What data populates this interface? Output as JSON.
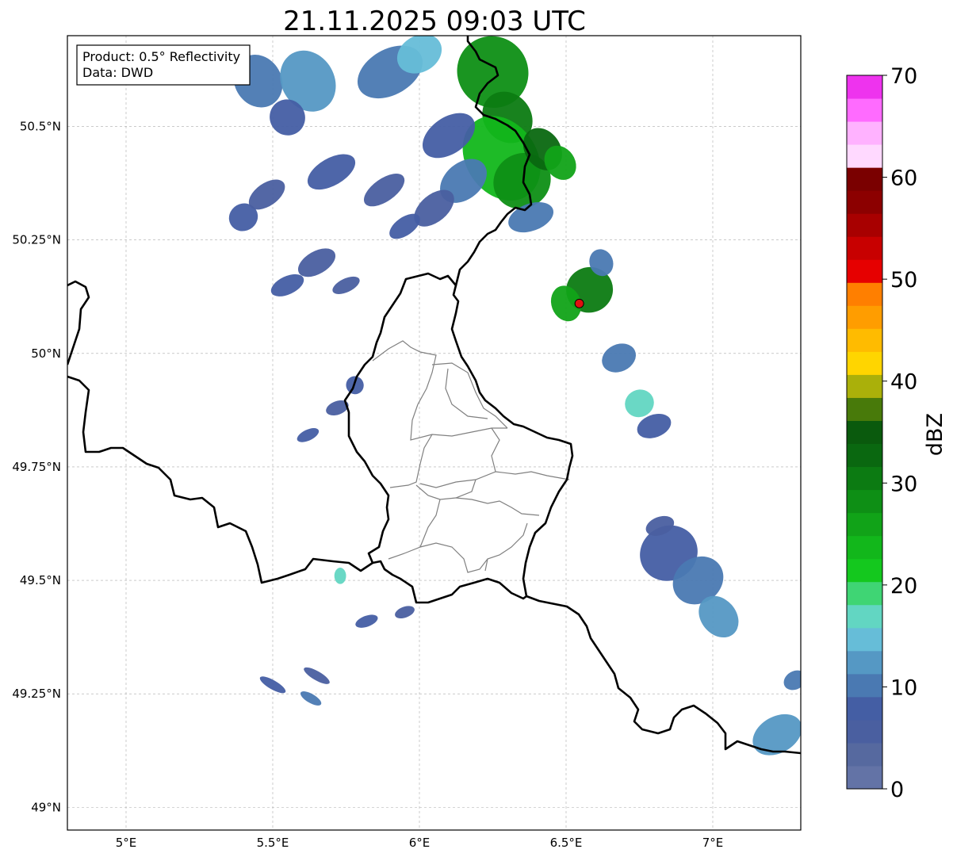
{
  "title": "21.11.2025 09:03 UTC",
  "legend": {
    "product": "Product: 0.5° Reflectivity",
    "data": "Data: DWD"
  },
  "axes": {
    "x_ticks": [
      {
        "value": 5.0,
        "label": "5°E"
      },
      {
        "value": 5.5,
        "label": "5.5°E"
      },
      {
        "value": 6.0,
        "label": "6°E"
      },
      {
        "value": 6.5,
        "label": "6.5°E"
      },
      {
        "value": 7.0,
        "label": "7°E"
      }
    ],
    "y_ticks": [
      {
        "value": 49.0,
        "label": "49°N"
      },
      {
        "value": 49.25,
        "label": "49.25°N"
      },
      {
        "value": 49.5,
        "label": "49.5°N"
      },
      {
        "value": 49.75,
        "label": "49.75°N"
      },
      {
        "value": 50.0,
        "label": "50°N"
      },
      {
        "value": 50.25,
        "label": "50.25°N"
      },
      {
        "value": 50.5,
        "label": "50.5°N"
      }
    ],
    "xlim": [
      4.8,
      7.3
    ],
    "ylim": [
      48.95,
      50.7
    ],
    "grid": true
  },
  "colorbar": {
    "label": "dBZ",
    "range": [
      0,
      70
    ],
    "tick_labels": [
      {
        "value": 0,
        "label": "0"
      },
      {
        "value": 10,
        "label": "10"
      },
      {
        "value": 20,
        "label": "20"
      },
      {
        "value": 30,
        "label": "30"
      },
      {
        "value": 40,
        "label": "40"
      },
      {
        "value": 50,
        "label": "50"
      },
      {
        "value": 60,
        "label": "60"
      },
      {
        "value": 70,
        "label": "70"
      }
    ],
    "colors": [
      "#6373a6",
      "#56699f",
      "#4a5fa0",
      "#445ea4",
      "#4a79b2",
      "#5598c4",
      "#66bdd8",
      "#62d6c2",
      "#3fd574",
      "#14c81e",
      "#12b71b",
      "#11a318",
      "#0e8f15",
      "#0c7b12",
      "#0a6810",
      "#0a5a0d",
      "#487a0a",
      "#aab00a",
      "#ffd500",
      "#ffbb00",
      "#ff9d00",
      "#ff7f00",
      "#e60000",
      "#c80000",
      "#a80000",
      "#8c0000",
      "#7a0000",
      "#ffd9ff",
      "#ffb2ff",
      "#ff6bff",
      "#ee33ee"
    ]
  },
  "marker": {
    "lon": 6.545,
    "lat": 50.11,
    "color": "#e01010"
  },
  "colors": {
    "border": "#000000",
    "district": "#808080",
    "grid": "#aaaaaa"
  },
  "echoes": [
    {
      "lon": 5.45,
      "lat": 50.6,
      "rx": 0.08,
      "ry": 0.06,
      "rot": -30,
      "c": 4
    },
    {
      "lon": 5.62,
      "lat": 50.6,
      "rx": 0.09,
      "ry": 0.07,
      "rot": -30,
      "c": 5
    },
    {
      "lon": 5.55,
      "lat": 50.52,
      "rx": 0.06,
      "ry": 0.04,
      "rot": -30,
      "c": 3
    },
    {
      "lon": 5.9,
      "lat": 50.62,
      "rx": 0.12,
      "ry": 0.05,
      "rot": -30,
      "c": 4
    },
    {
      "lon": 6.0,
      "lat": 50.66,
      "rx": 0.08,
      "ry": 0.04,
      "rot": -30,
      "c": 6
    },
    {
      "lon": 6.25,
      "lat": 50.62,
      "rx": 0.12,
      "ry": 0.08,
      "rot": -40,
      "c": 12
    },
    {
      "lon": 6.3,
      "lat": 50.52,
      "rx": 0.08,
      "ry": 0.06,
      "rot": -40,
      "c": 13
    },
    {
      "lon": 6.28,
      "lat": 50.43,
      "rx": 0.12,
      "ry": 0.1,
      "rot": -35,
      "c": 10
    },
    {
      "lon": 6.35,
      "lat": 50.38,
      "rx": 0.1,
      "ry": 0.06,
      "rot": -35,
      "c": 12
    },
    {
      "lon": 6.42,
      "lat": 50.45,
      "rx": 0.06,
      "ry": 0.05,
      "rot": -35,
      "c": 14
    },
    {
      "lon": 6.48,
      "lat": 50.42,
      "rx": 0.05,
      "ry": 0.04,
      "rot": -35,
      "c": 11
    },
    {
      "lon": 6.1,
      "lat": 50.48,
      "rx": 0.1,
      "ry": 0.04,
      "rot": -35,
      "c": 3
    },
    {
      "lon": 6.15,
      "lat": 50.38,
      "rx": 0.09,
      "ry": 0.04,
      "rot": -40,
      "c": 4
    },
    {
      "lon": 6.05,
      "lat": 50.32,
      "rx": 0.08,
      "ry": 0.03,
      "rot": -40,
      "c": 2
    },
    {
      "lon": 6.38,
      "lat": 50.3,
      "rx": 0.08,
      "ry": 0.03,
      "rot": -20,
      "c": 4
    },
    {
      "lon": 5.4,
      "lat": 50.3,
      "rx": 0.05,
      "ry": 0.03,
      "rot": -30,
      "c": 3
    },
    {
      "lon": 5.48,
      "lat": 50.35,
      "rx": 0.07,
      "ry": 0.025,
      "rot": -35,
      "c": 2
    },
    {
      "lon": 5.7,
      "lat": 50.4,
      "rx": 0.09,
      "ry": 0.03,
      "rot": -30,
      "c": 3
    },
    {
      "lon": 5.88,
      "lat": 50.36,
      "rx": 0.08,
      "ry": 0.025,
      "rot": -35,
      "c": 2
    },
    {
      "lon": 5.95,
      "lat": 50.28,
      "rx": 0.06,
      "ry": 0.02,
      "rot": -35,
      "c": 3
    },
    {
      "lon": 5.65,
      "lat": 50.2,
      "rx": 0.07,
      "ry": 0.025,
      "rot": -30,
      "c": 2
    },
    {
      "lon": 5.55,
      "lat": 50.15,
      "rx": 0.06,
      "ry": 0.02,
      "rot": -25,
      "c": 3
    },
    {
      "lon": 5.75,
      "lat": 50.15,
      "rx": 0.05,
      "ry": 0.015,
      "rot": -25,
      "c": 2
    },
    {
      "lon": 6.58,
      "lat": 50.14,
      "rx": 0.08,
      "ry": 0.05,
      "rot": -20,
      "c": 13
    },
    {
      "lon": 6.5,
      "lat": 50.11,
      "rx": 0.05,
      "ry": 0.04,
      "rot": -20,
      "c": 11
    },
    {
      "lon": 6.62,
      "lat": 50.2,
      "rx": 0.04,
      "ry": 0.03,
      "rot": -20,
      "c": 4
    },
    {
      "lon": 6.68,
      "lat": 49.99,
      "rx": 0.06,
      "ry": 0.03,
      "rot": -25,
      "c": 4
    },
    {
      "lon": 6.75,
      "lat": 49.89,
      "rx": 0.05,
      "ry": 0.03,
      "rot": -25,
      "c": 7
    },
    {
      "lon": 6.8,
      "lat": 49.84,
      "rx": 0.06,
      "ry": 0.025,
      "rot": -20,
      "c": 3
    },
    {
      "lon": 6.85,
      "lat": 49.56,
      "rx": 0.1,
      "ry": 0.06,
      "rot": -30,
      "c": 3
    },
    {
      "lon": 6.95,
      "lat": 49.5,
      "rx": 0.09,
      "ry": 0.05,
      "rot": -35,
      "c": 4
    },
    {
      "lon": 7.02,
      "lat": 49.42,
      "rx": 0.06,
      "ry": 0.05,
      "rot": -40,
      "c": 5
    },
    {
      "lon": 6.82,
      "lat": 49.62,
      "rx": 0.05,
      "ry": 0.02,
      "rot": -20,
      "c": 2
    },
    {
      "lon": 7.22,
      "lat": 49.16,
      "rx": 0.09,
      "ry": 0.04,
      "rot": -30,
      "c": 5
    },
    {
      "lon": 7.28,
      "lat": 49.28,
      "rx": 0.04,
      "ry": 0.02,
      "rot": -30,
      "c": 4
    },
    {
      "lon": 5.73,
      "lat": 49.51,
      "rx": 0.02,
      "ry": 0.018,
      "rot": 0,
      "c": 7
    },
    {
      "lon": 5.82,
      "lat": 49.41,
      "rx": 0.04,
      "ry": 0.012,
      "rot": -20,
      "c": 3
    },
    {
      "lon": 5.95,
      "lat": 49.43,
      "rx": 0.035,
      "ry": 0.012,
      "rot": -20,
      "c": 2
    },
    {
      "lon": 5.5,
      "lat": 49.27,
      "rx": 0.05,
      "ry": 0.01,
      "rot": 30,
      "c": 3
    },
    {
      "lon": 5.65,
      "lat": 49.29,
      "rx": 0.05,
      "ry": 0.01,
      "rot": 30,
      "c": 2
    },
    {
      "lon": 5.63,
      "lat": 49.24,
      "rx": 0.04,
      "ry": 0.01,
      "rot": 30,
      "c": 4
    },
    {
      "lon": 5.78,
      "lat": 49.93,
      "rx": 0.03,
      "ry": 0.02,
      "rot": -20,
      "c": 3
    },
    {
      "lon": 5.72,
      "lat": 49.88,
      "rx": 0.04,
      "ry": 0.015,
      "rot": -20,
      "c": 2
    },
    {
      "lon": 5.62,
      "lat": 49.82,
      "rx": 0.04,
      "ry": 0.012,
      "rot": -25,
      "c": 3
    }
  ]
}
